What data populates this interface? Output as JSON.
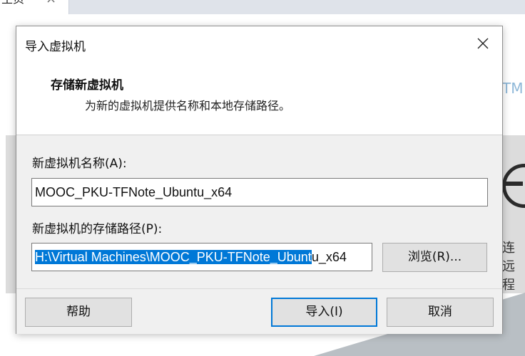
{
  "background": {
    "tab_label": "主页",
    "tab_close": "×",
    "logo_text": "TM",
    "side_text": "连远程"
  },
  "dialog": {
    "title": "导入虚拟机",
    "close_icon": "close-icon",
    "heading": "存储新虚拟机",
    "description": "为新的虚拟机提供名称和本地存储路径。",
    "name_label": "新虚拟机名称(A):",
    "name_value": "MOOC_PKU-TFNote_Ubuntu_x64",
    "path_label": "新虚拟机的存储路径(P):",
    "path_value_selected": "H:\\Virtual Machines\\MOOC_PKU-TFNote_Ubunt",
    "path_value_rest": "u_x64",
    "browse_label": "浏览(R)...",
    "help_label": "帮助",
    "import_label": "导入(I)",
    "cancel_label": "取消"
  },
  "colors": {
    "accent": "#0078d7",
    "body_bg": "#f0f0f0"
  }
}
